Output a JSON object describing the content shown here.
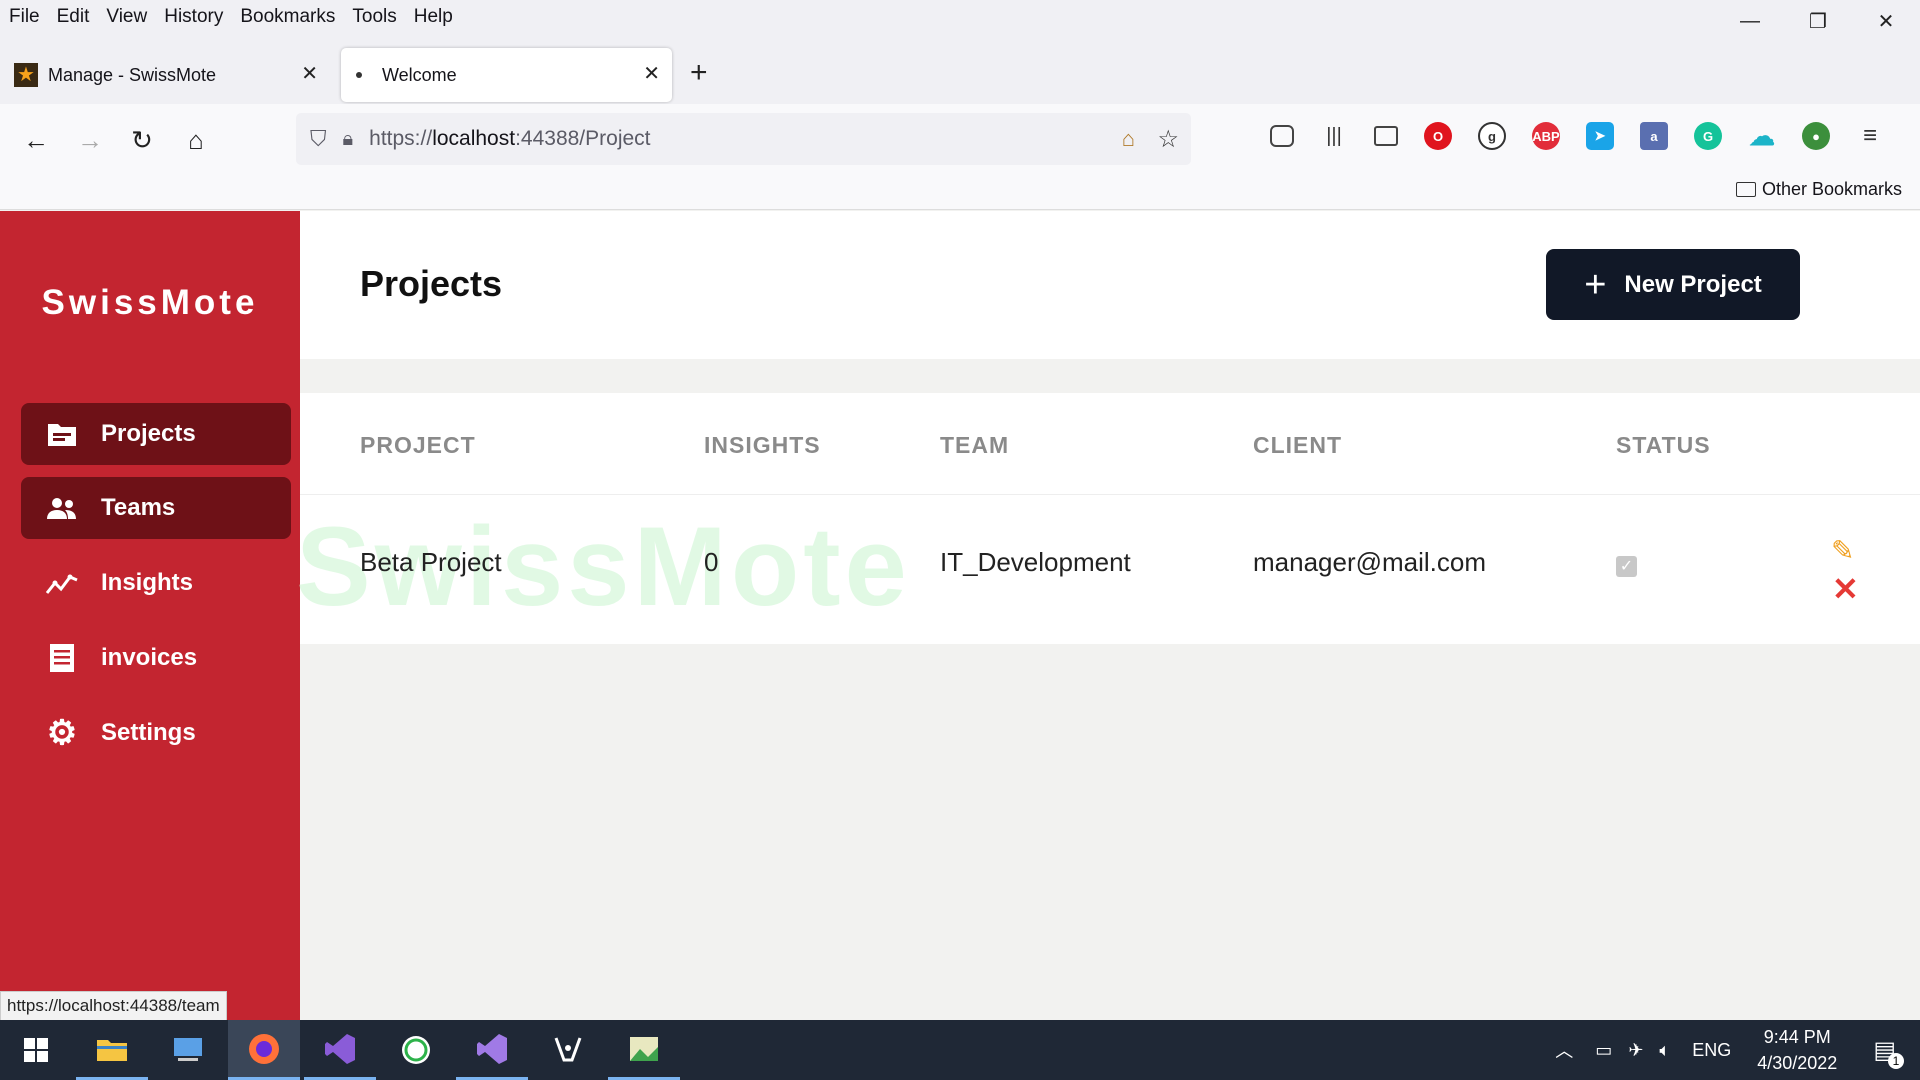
{
  "menubar": {
    "items": [
      "File",
      "Edit",
      "View",
      "History",
      "Bookmarks",
      "Tools",
      "Help"
    ]
  },
  "window_controls": {
    "minimize": "—",
    "restore": "❐",
    "close": "✕"
  },
  "tabs": [
    {
      "label": "Manage - SwissMote",
      "active": false
    },
    {
      "label": "Welcome",
      "active": true
    }
  ],
  "urlbar": {
    "prefix": "https://",
    "host": "localhost",
    "path": ":44388/Project"
  },
  "bookmarks": {
    "other": "Other Bookmarks"
  },
  "app": {
    "brand": "SwissMote",
    "nav": [
      {
        "label": "Projects",
        "icon": "folder-icon",
        "active": true
      },
      {
        "label": "Teams",
        "icon": "users-icon",
        "active": true
      },
      {
        "label": "Insights",
        "icon": "chart-line-icon",
        "active": false
      },
      {
        "label": "invoices",
        "icon": "receipt-icon",
        "active": false
      },
      {
        "label": "Settings",
        "icon": "gear-icon",
        "active": false
      }
    ],
    "page_title": "Projects",
    "new_button": "New Project",
    "watermark": "SwissMote",
    "columns": [
      "PROJECT",
      "INSIGHTS",
      "TEAM",
      "CLIENT",
      "STATUS"
    ],
    "rows": [
      {
        "project": "Beta Project",
        "insights": "0",
        "team": "IT_Development",
        "client": "manager@mail.com",
        "status": true
      }
    ]
  },
  "statusbar": {
    "link": "https://localhost:44388/team"
  },
  "taskbar": {
    "lang": "ENG",
    "time": "9:44 PM",
    "date": "4/30/2022",
    "notifications": "1"
  }
}
